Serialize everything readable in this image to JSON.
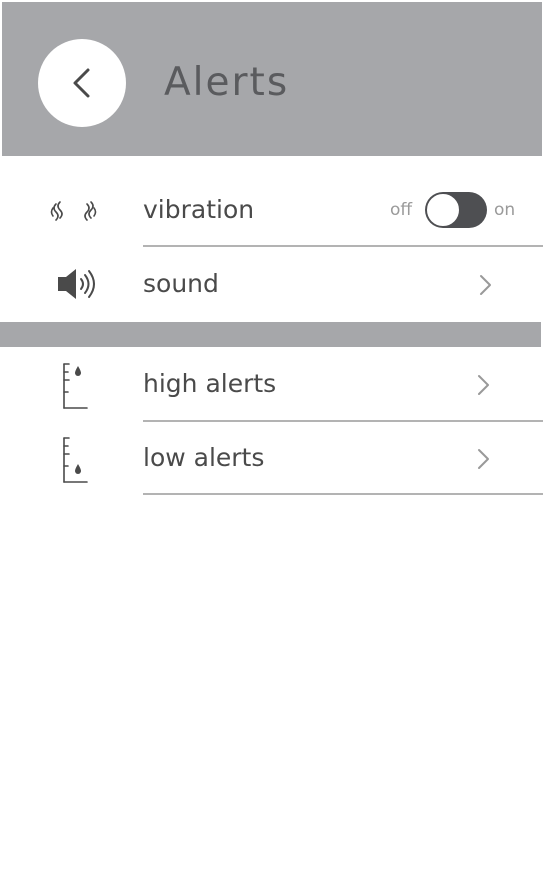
{
  "header": {
    "back_icon": "chevron-left-icon",
    "title": "Alerts"
  },
  "settings": {
    "vibration": {
      "icon": "vibration-icon",
      "label": "vibration",
      "toggle_off_label": "off",
      "toggle_on_label": "on",
      "toggle_state": "on"
    },
    "sound": {
      "icon": "speaker-icon",
      "label": "sound",
      "chevron_icon": "chevron-right-icon"
    }
  },
  "alerts": {
    "high": {
      "icon": "high-glucose-icon",
      "label": "high alerts",
      "chevron_icon": "chevron-right-icon"
    },
    "low": {
      "icon": "low-glucose-icon",
      "label": "low alerts",
      "chevron_icon": "chevron-right-icon"
    }
  },
  "colors": {
    "header_bg": "#a6a7aa",
    "title_text": "#5a5b5e",
    "toggle_track": "#4e4f52",
    "divider": "#b3b3b3"
  }
}
